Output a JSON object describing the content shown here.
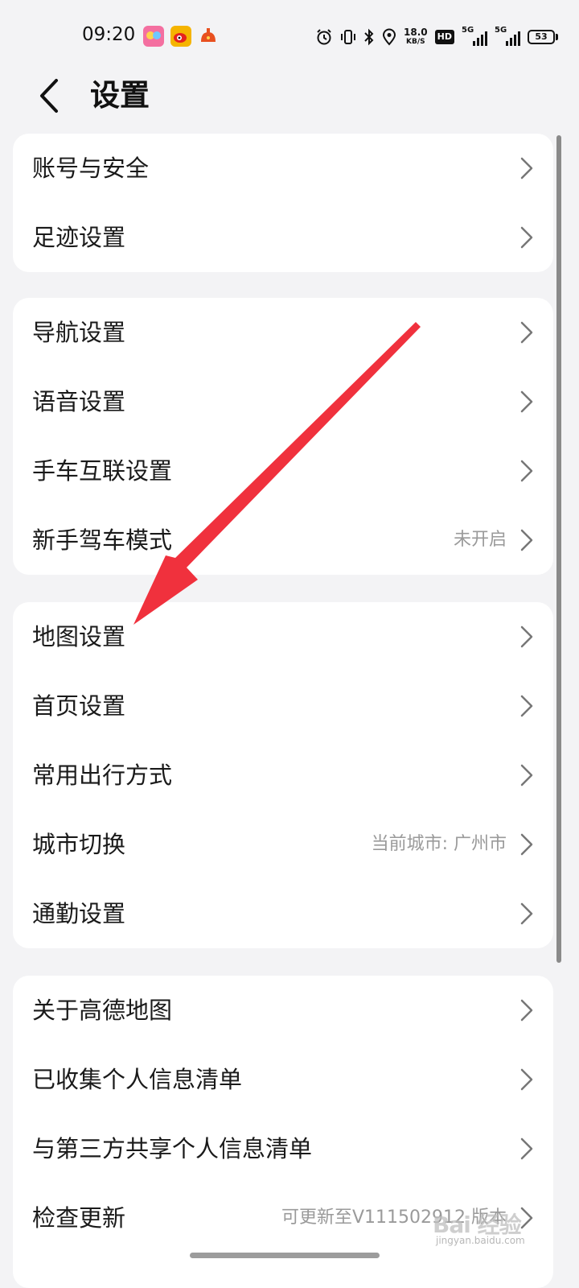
{
  "status_bar": {
    "time": "09:20",
    "notification_icons": [
      "photo-app-icon",
      "weibo-icon",
      "alert-app-icon"
    ],
    "network_speed": "18.0",
    "network_speed_unit": "KB/S",
    "hd_label": "HD",
    "sim1_label": "5G",
    "sim2_label": "5G",
    "battery_level": "53"
  },
  "header": {
    "title": "设置"
  },
  "groups": [
    {
      "items": [
        {
          "label": "账号与安全"
        },
        {
          "label": "足迹设置"
        }
      ]
    },
    {
      "items": [
        {
          "label": "导航设置"
        },
        {
          "label": "语音设置"
        },
        {
          "label": "手车互联设置"
        },
        {
          "label": "新手驾车模式",
          "value": "未开启"
        }
      ]
    },
    {
      "items": [
        {
          "label": "地图设置"
        },
        {
          "label": "首页设置"
        },
        {
          "label": "常用出行方式"
        },
        {
          "label": "城市切换",
          "value": "当前城市: 广州市"
        },
        {
          "label": "通勤设置"
        }
      ]
    },
    {
      "items": [
        {
          "label": "关于高德地图"
        },
        {
          "label": "已收集个人信息清单"
        },
        {
          "label": "与第三方共享个人信息清单"
        },
        {
          "label": "检查更新",
          "value": "可更新至V111502912 版本"
        }
      ]
    }
  ],
  "annotation": {
    "color": "#f0313d"
  },
  "watermark": {
    "brand": "Bai 经验",
    "url": "jingyan.baidu.com"
  }
}
